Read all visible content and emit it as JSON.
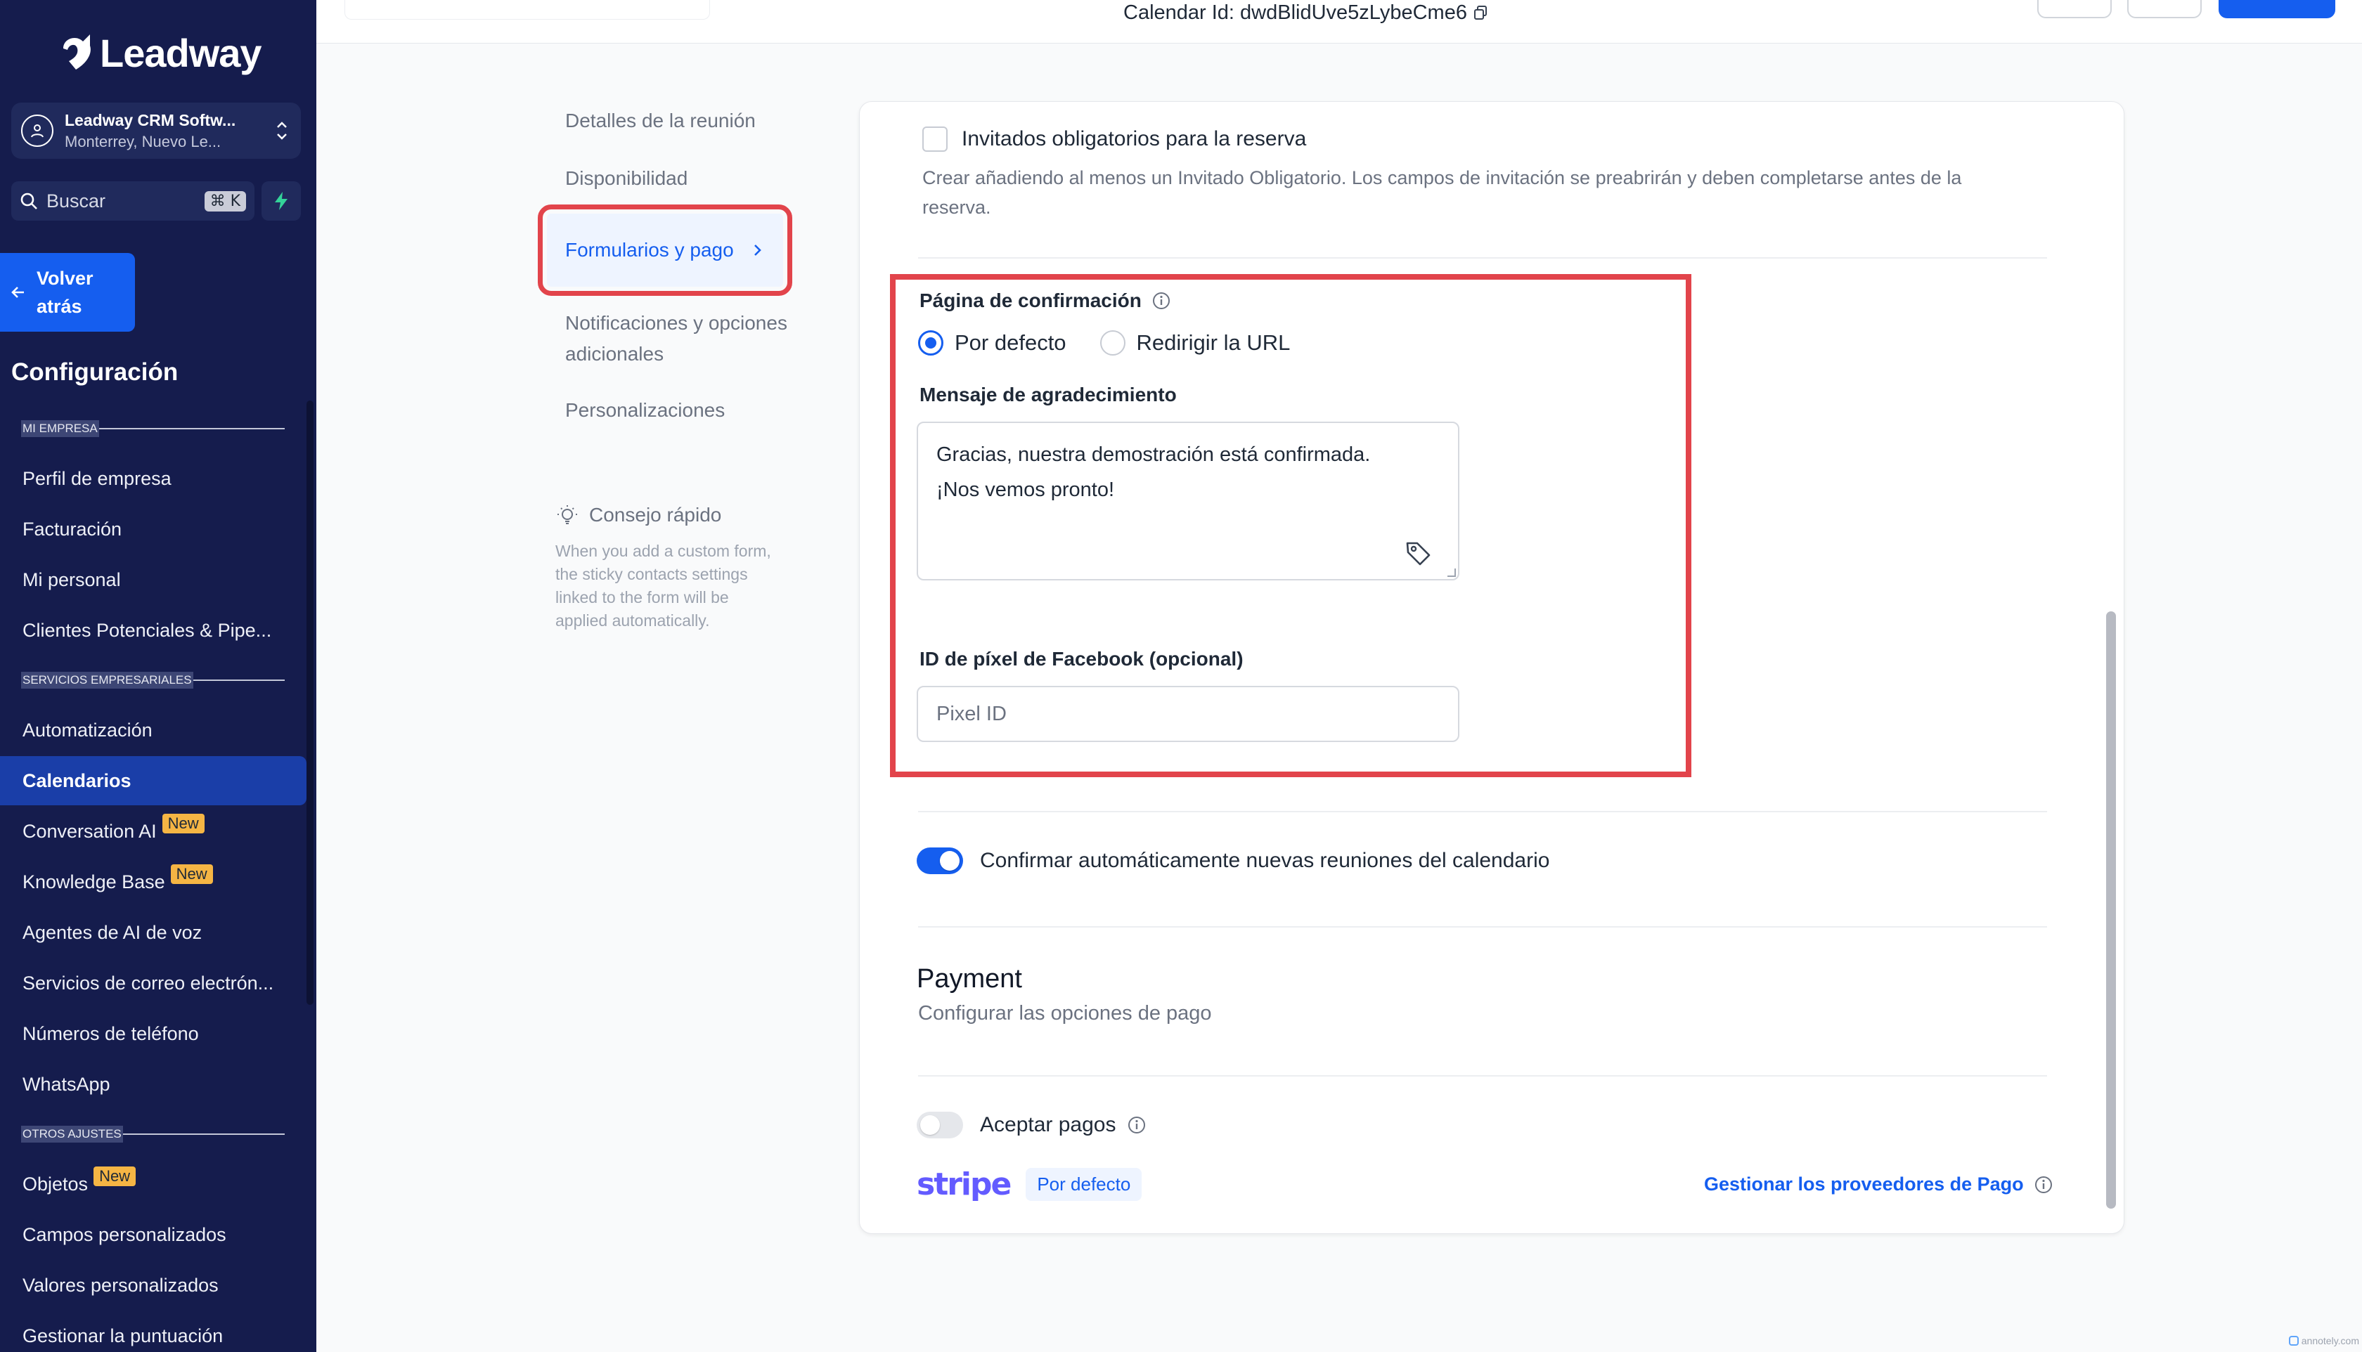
{
  "brand": {
    "name": "Leadway"
  },
  "account": {
    "name": "Leadway CRM Softw...",
    "location": "Monterrey, Nuevo Le..."
  },
  "search": {
    "label": "Buscar",
    "shortcut": "⌘ K"
  },
  "back_button": {
    "label": "Volver atrás"
  },
  "sidebar": {
    "title": "Configuración",
    "sections": [
      {
        "label": "MI EMPRESA"
      },
      {
        "label": "SERVICIOS EMPRESARIALES"
      },
      {
        "label": "OTROS AJUSTES"
      }
    ],
    "items": [
      {
        "label": "Perfil de empresa"
      },
      {
        "label": "Facturación"
      },
      {
        "label": "Mi personal"
      },
      {
        "label": "Clientes Potenciales & Pipe..."
      },
      {
        "label": "Automatización"
      },
      {
        "label": "Calendarios",
        "active": true
      },
      {
        "label": "Conversation AI",
        "badge": "New"
      },
      {
        "label": "Knowledge Base",
        "badge": "New"
      },
      {
        "label": "Agentes de AI de voz"
      },
      {
        "label": "Servicios de correo electrón..."
      },
      {
        "label": "Números de teléfono"
      },
      {
        "label": "WhatsApp"
      },
      {
        "label": "Objetos",
        "badge": "New"
      },
      {
        "label": "Campos personalizados"
      },
      {
        "label": "Valores personalizados"
      },
      {
        "label": "Gestionar la puntuación"
      }
    ]
  },
  "topbar": {
    "calendar_id": "Calendar Id: dwdBlidUve5zLybeCme6"
  },
  "steps": [
    {
      "label": "Detalles de la reunión"
    },
    {
      "label": "Disponibilidad"
    },
    {
      "label": "Formularios y pago",
      "active": true
    },
    {
      "label": "Notificaciones y opciones adicionales"
    },
    {
      "label": "Personalizaciones"
    }
  ],
  "tip": {
    "title": "Consejo rápido",
    "body": "When you add a custom form, the sticky contacts settings linked to the form will be applied automatically."
  },
  "form": {
    "mandatory_guests": {
      "label": "Invitados obligatorios para la reserva",
      "checked": false,
      "description": "Crear añadiendo al menos un Invitado Obligatorio. Los campos de invitación se preabrirán y deben completarse antes de la reserva."
    },
    "confirmation_page": {
      "title": "Página de confirmación",
      "options": [
        "Por defecto",
        "Redirigir la URL"
      ],
      "selected": "Por defecto"
    },
    "thank_you": {
      "label": "Mensaje de agradecimiento",
      "line1": "Gracias, nuestra demostración está confirmada.",
      "line2": "¡Nos vemos pronto!"
    },
    "facebook_pixel": {
      "label": "ID de píxel de Facebook (opcional)",
      "placeholder": "Pixel ID",
      "value": ""
    },
    "auto_confirm": {
      "label": "Confirmar automáticamente nuevas reuniones del calendario",
      "enabled": true
    }
  },
  "payment": {
    "title": "Payment",
    "subtitle": "Configurar las opciones de pago",
    "accept_payments": {
      "label": "Aceptar pagos",
      "enabled": false
    },
    "provider": {
      "logo": "stripe",
      "badge": "Por defecto"
    },
    "manage_link": "Gestionar los proveedores de Pago"
  },
  "watermark": "annotely.com",
  "colors": {
    "sidebar_bg": "#151c4d",
    "accent": "#155eef",
    "highlight_border": "#e2444b",
    "badge": "#f5b544"
  }
}
